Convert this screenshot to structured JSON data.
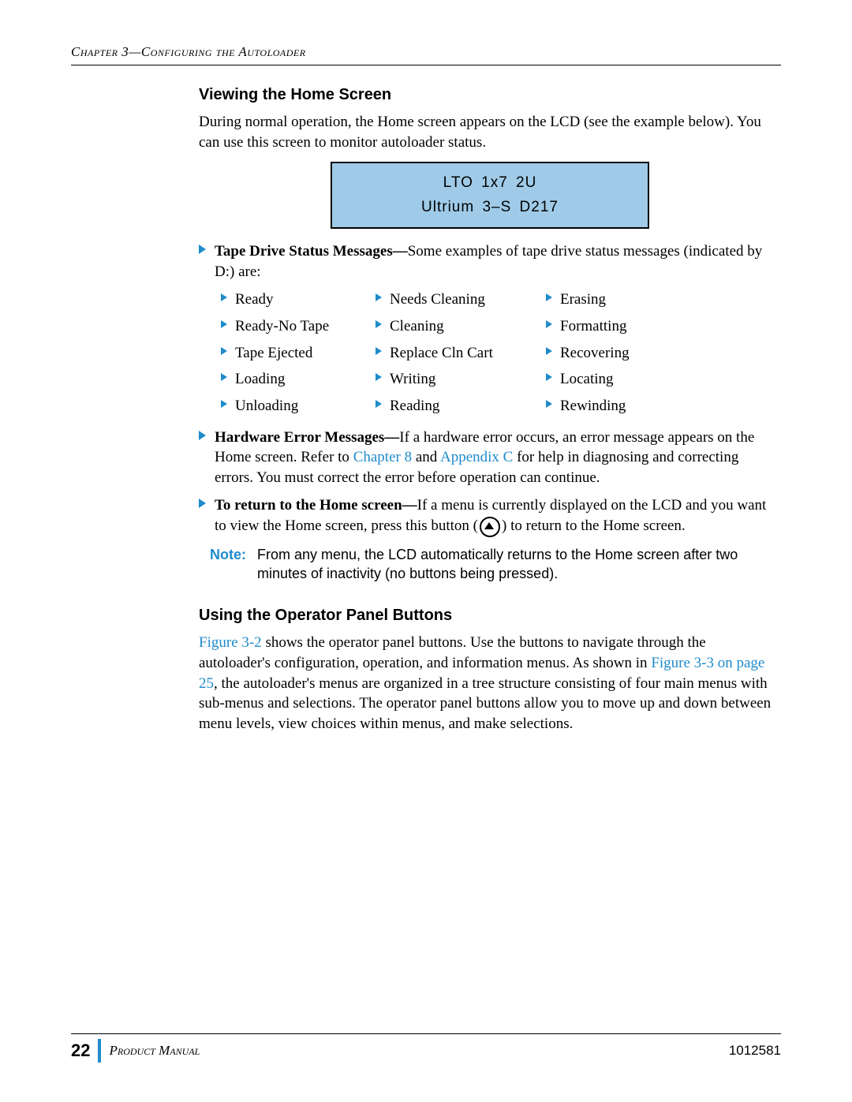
{
  "running_head": "Chapter 3—Configuring the Autoloader",
  "section1": {
    "title": "Viewing the Home Screen",
    "intro": "During normal operation, the Home screen appears on the LCD (see the example below). You can use this screen to monitor autoloader status."
  },
  "lcd": {
    "line1": "LTO   1x7   2U",
    "line2": "Ultrium 3–S   D217"
  },
  "tape_status": {
    "lead_bold": "Tape Drive Status Messages—",
    "lead_rest": "Some examples of tape drive status messages (indicated by D:) are:",
    "items": [
      "Ready",
      "Needs Cleaning",
      "Erasing",
      "Ready-No Tape",
      "Cleaning",
      "Formatting",
      "Tape Ejected",
      "Replace Cln Cart",
      "Recovering",
      "Loading",
      "Writing",
      "Locating",
      "Unloading",
      "Reading",
      "Rewinding"
    ]
  },
  "hw_error": {
    "lead_bold": "Hardware Error Messages—",
    "t1": "If a hardware error occurs, an error message appears on the Home screen. Refer to ",
    "link1": "Chapter 8",
    "t2": " and ",
    "link2": "Appendix C",
    "t3": " for help in diagnosing and correcting errors. You must correct the error before operation can continue."
  },
  "return_home": {
    "lead_bold": "To return to the Home screen—",
    "t1": "If a menu is currently displayed on the LCD and you want to view the Home screen, press this button (",
    "t2": ") to return to the Home screen."
  },
  "note": {
    "label": "Note:",
    "text": "From any menu, the LCD automatically returns to the Home screen after two minutes of inactivity (no buttons being pressed)."
  },
  "section2": {
    "title": "Using the Operator Panel Buttons",
    "link1": "Figure 3-2",
    "t1": " shows the operator panel buttons. Use the buttons to navigate through the autoloader's configuration, operation, and information menus. As shown in ",
    "link2": "Figure 3-3 on page 25",
    "t2": ", the autoloader's menus are organized in a tree structure consisting of four main menus with sub-menus and selections. The operator panel buttons allow you to move up and down between menu levels, view choices within menus, and make selections."
  },
  "footer": {
    "page": "22",
    "title": "Product Manual",
    "docnum": "1012581"
  }
}
